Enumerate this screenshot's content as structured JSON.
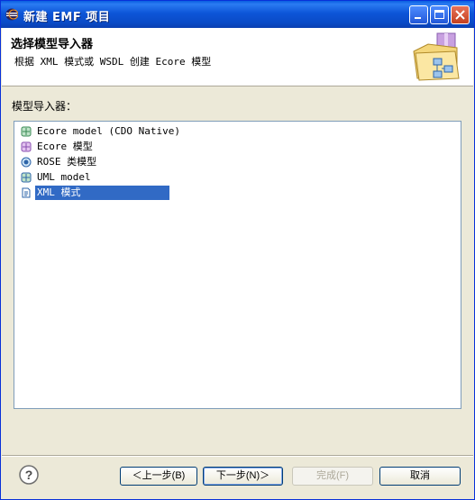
{
  "window": {
    "title": "新建 EMF 项目"
  },
  "header": {
    "title": "选择模型导入器",
    "description": "根据 XML 模式或 WSDL 创建 Ecore 模型"
  },
  "importers": {
    "label": "模型导入器：",
    "items": [
      {
        "label": "Ecore model (CDO Native)",
        "icon": "cdo-icon"
      },
      {
        "label": "Ecore 模型",
        "icon": "ecore-icon"
      },
      {
        "label": "ROSE 类模型",
        "icon": "rose-icon"
      },
      {
        "label": "UML model",
        "icon": "uml-icon"
      },
      {
        "label": "XML 模式",
        "icon": "xsd-icon",
        "selected": true
      }
    ]
  },
  "buttons": {
    "back": "＜上一步(B)",
    "next": "下一步(N)＞",
    "finish": "完成(F)",
    "cancel": "取消"
  }
}
